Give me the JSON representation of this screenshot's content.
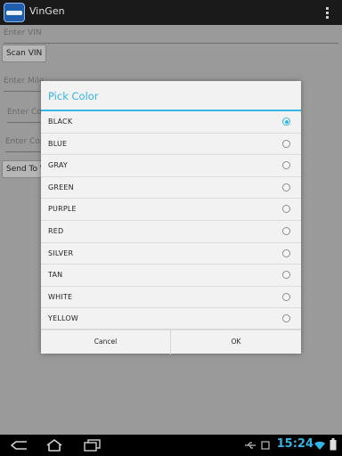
{
  "app": {
    "title": "VinGen"
  },
  "form": {
    "vin_placeholder": "Enter VIN",
    "scan_label": "Scan VIN",
    "mileage_placeholder": "Enter Mile",
    "color_placeholder": "Enter Col",
    "cost_placeholder": "Enter Cos",
    "send_label": "Send To W"
  },
  "dialog": {
    "title": "Pick Color",
    "options": [
      {
        "label": "BLACK",
        "checked": true
      },
      {
        "label": "BLUE",
        "checked": false
      },
      {
        "label": "GRAY",
        "checked": false
      },
      {
        "label": "GREEN",
        "checked": false
      },
      {
        "label": "PURPLE",
        "checked": false
      },
      {
        "label": "RED",
        "checked": false
      },
      {
        "label": "SILVER",
        "checked": false
      },
      {
        "label": "TAN",
        "checked": false
      },
      {
        "label": "WHITE",
        "checked": false
      },
      {
        "label": "YELLOW",
        "checked": false
      }
    ],
    "cancel_label": "Cancel",
    "ok_label": "OK"
  },
  "status": {
    "time": "15:24"
  },
  "icons": {
    "back": "back-icon",
    "home": "home-icon",
    "recents": "recents-icon",
    "usb": "usb-icon",
    "wifi": "wifi-icon",
    "battery": "battery-icon"
  },
  "colors": {
    "accent": "#33b5e5",
    "actionbar": "#1a1a1a",
    "dim": "#9a9a9a"
  }
}
